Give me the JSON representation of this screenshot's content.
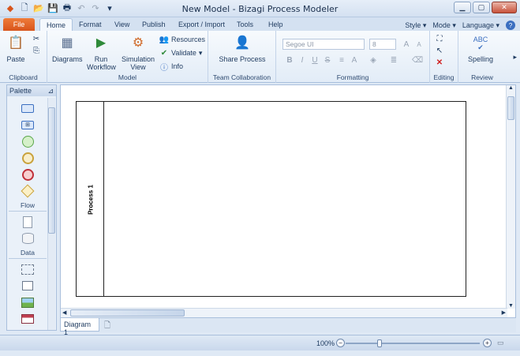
{
  "window": {
    "title": "New Model - Bizagi Process Modeler"
  },
  "menu_tabs": [
    {
      "label": "File"
    },
    {
      "label": "Home"
    },
    {
      "label": "Format"
    },
    {
      "label": "View"
    },
    {
      "label": "Publish"
    },
    {
      "label": "Export / Import"
    },
    {
      "label": "Tools"
    },
    {
      "label": "Help"
    }
  ],
  "right_menu": {
    "style": "Style",
    "mode": "Mode",
    "language": "Language"
  },
  "ribbon": {
    "clipboard": {
      "paste": "Paste",
      "group": "Clipboard"
    },
    "model": {
      "diagrams": "Diagrams",
      "run_workflow_1": "Run",
      "run_workflow_2": "Workflow",
      "simulation_1": "Simulation",
      "simulation_2": "View",
      "resources": "Resources",
      "validate": "Validate",
      "info": "Info",
      "group": "Model"
    },
    "team": {
      "share": "Share Process",
      "group": "Team Collaboration"
    },
    "formatting": {
      "font": "Segoe UI",
      "size": "8",
      "group": "Formatting"
    },
    "editing": {
      "group": "Editing"
    },
    "review": {
      "spelling": "Spelling",
      "group": "Review",
      "abc": "ABC"
    }
  },
  "palette": {
    "title": "Palette",
    "flow_label": "Flow",
    "data_label": "Data"
  },
  "canvas": {
    "pool_name": "Process 1"
  },
  "doc_tabs": [
    {
      "label": "Diagram 1"
    }
  ],
  "status": {
    "zoom": "100%"
  },
  "colors": {
    "accent": "#d8541b",
    "ribbon_border": "#a9bfdc"
  }
}
